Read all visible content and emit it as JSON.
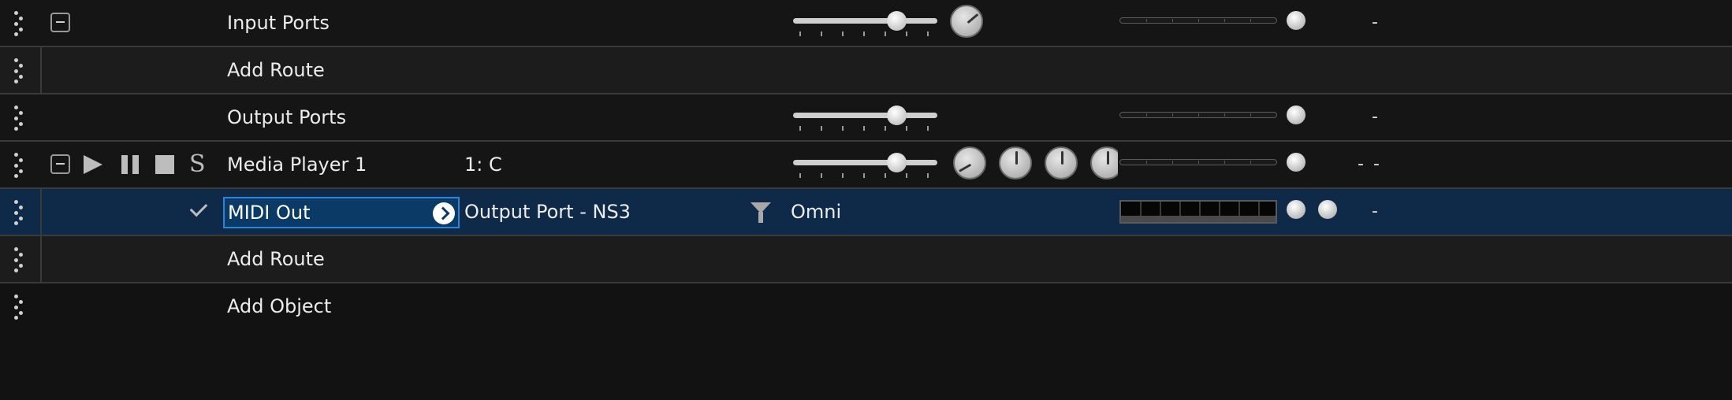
{
  "rows": [
    {
      "label": "Input Ports",
      "meter_value": "-"
    },
    {
      "label": "Add Route"
    },
    {
      "label": "Output Ports",
      "meter_value": "-"
    },
    {
      "label": "Media Player 1",
      "note": "1: C",
      "meter_value_a": "-",
      "meter_value_b": "-",
      "solo_label": "S"
    },
    {
      "name": "MIDI Out",
      "port": "Output Port - NS3",
      "channel": "Omni",
      "meter_value": "-"
    },
    {
      "label": "Add Route"
    },
    {
      "label": "Add Object"
    }
  ],
  "colors": {
    "background": "#121212",
    "selection": "#0e2a48",
    "accent": "#2b86d9"
  },
  "icons": {
    "drag_handle": "drag-handle-icon",
    "collapse": "collapse-icon",
    "play": "play-icon",
    "pause": "pause-icon",
    "stop": "stop-icon",
    "enabled": "check-icon",
    "go": "chevron-right-icon",
    "filter": "filter-icon"
  }
}
